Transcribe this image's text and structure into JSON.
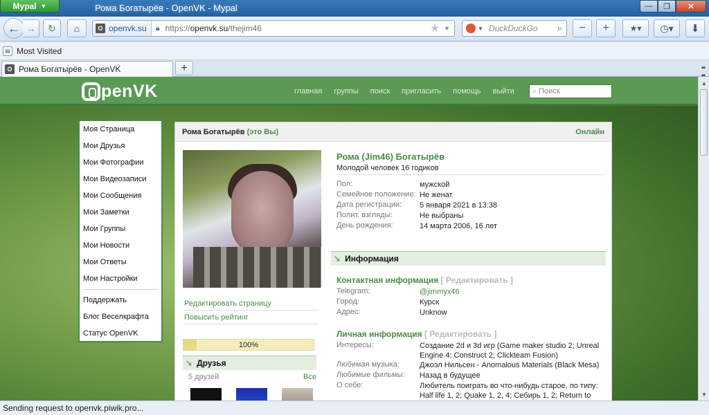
{
  "window": {
    "app_button": "Mypal",
    "title": "Рома Богатырёв - OpenVK - Mypal",
    "min": "—",
    "max": "❐",
    "close": "✕"
  },
  "navbar": {
    "back": "←",
    "forward": "→",
    "reload": "↻",
    "home": "⌂",
    "site_identity": "openvk.su",
    "url_prefix": "https://",
    "url_host": "openvk.su",
    "url_path": "/thejim46",
    "star": "★",
    "search_placeholder": "DuckDuckGo",
    "zoom_out": "−",
    "zoom_in": "+",
    "addons": "★▾",
    "history": "◷▾",
    "download": "⬇"
  },
  "bookmarks": {
    "most_visited": "Most Visited"
  },
  "tabs": [
    {
      "label": "Рома Богатырёв - OpenVK"
    }
  ],
  "newtab": "+",
  "site": {
    "logo_suffix": "penVK",
    "nav": [
      "главная",
      "группы",
      "поиск",
      "пригласить",
      "помощь",
      "выйти"
    ],
    "search_placeholder": "Поиск"
  },
  "left_menu": {
    "main": [
      "Моя Страница",
      "Мои Друзья",
      "Мои Фотографии",
      "Мои Видеозаписи",
      "Мои Сообщения",
      "Мои Заметки",
      "Мои Группы",
      "Мои Новости",
      "Мои Ответы",
      "Мои Настройки"
    ],
    "extra": [
      "Поддержать",
      "Блог Веселкрафта",
      "Статус OpenVK"
    ]
  },
  "profile": {
    "header_name": "Рома Богатырёв",
    "header_me": "(это Вы)",
    "online": "Онлайн",
    "full_name": "Рома (Jim46) Богатырёв",
    "status": "Молодой человек 16 годиков",
    "basic": [
      {
        "k": "Пол:",
        "v": "мужской"
      },
      {
        "k": "Семейное положение:",
        "v": "Не женат"
      },
      {
        "k": "Дата регистрации:",
        "v": "5 января 2021 в 13:38"
      },
      {
        "k": "Полит. взгляды:",
        "v": "Не выбраны"
      },
      {
        "k": "День рождения:",
        "v": "14 марта 2006, 16 лет"
      }
    ],
    "info_header": "Информация",
    "contact_title": "Контактная информация",
    "edit": "[ Редактировать ]",
    "contact": [
      {
        "k": "Telegram:",
        "v": "@jimmyx46"
      },
      {
        "k": "Город:",
        "v": "Курск"
      },
      {
        "k": "Адрес:",
        "v": "Unknow"
      }
    ],
    "personal_title": "Личная информация",
    "personal": [
      {
        "k": "Интересы:",
        "v": "Создание 2d и 3d игр (Game maker studio 2; Unreal Engine 4; Construct 2; Clickteam Fusion)"
      },
      {
        "k": "Любимая музыка:",
        "v": "Джоэл Нильсен - Anomalous Materials (Black Mesa)"
      },
      {
        "k": "Любимые фильмы:",
        "v": "Назад в будущее"
      },
      {
        "k": "О себе:",
        "v": "Любитель поиграть во что-нибудь старое, по типу: Half life 1, 2; Quake 1, 2, 4; Себирь 1, 2; Return to castle Wolfenstein и т. п."
      }
    ],
    "edit_page": "Редактировать страницу",
    "raise_rating": "Повысить рейтинг",
    "rating_text": "100%",
    "rating_fraction": 0.1,
    "friends_title": "Друзья",
    "friends_count": "5 друзей",
    "friends_all": "Все"
  },
  "status_bar": "Sending request to openvk.piwik.pro...",
  "colors": {
    "accent": "#4a8a46",
    "header": "#5a9a55"
  }
}
